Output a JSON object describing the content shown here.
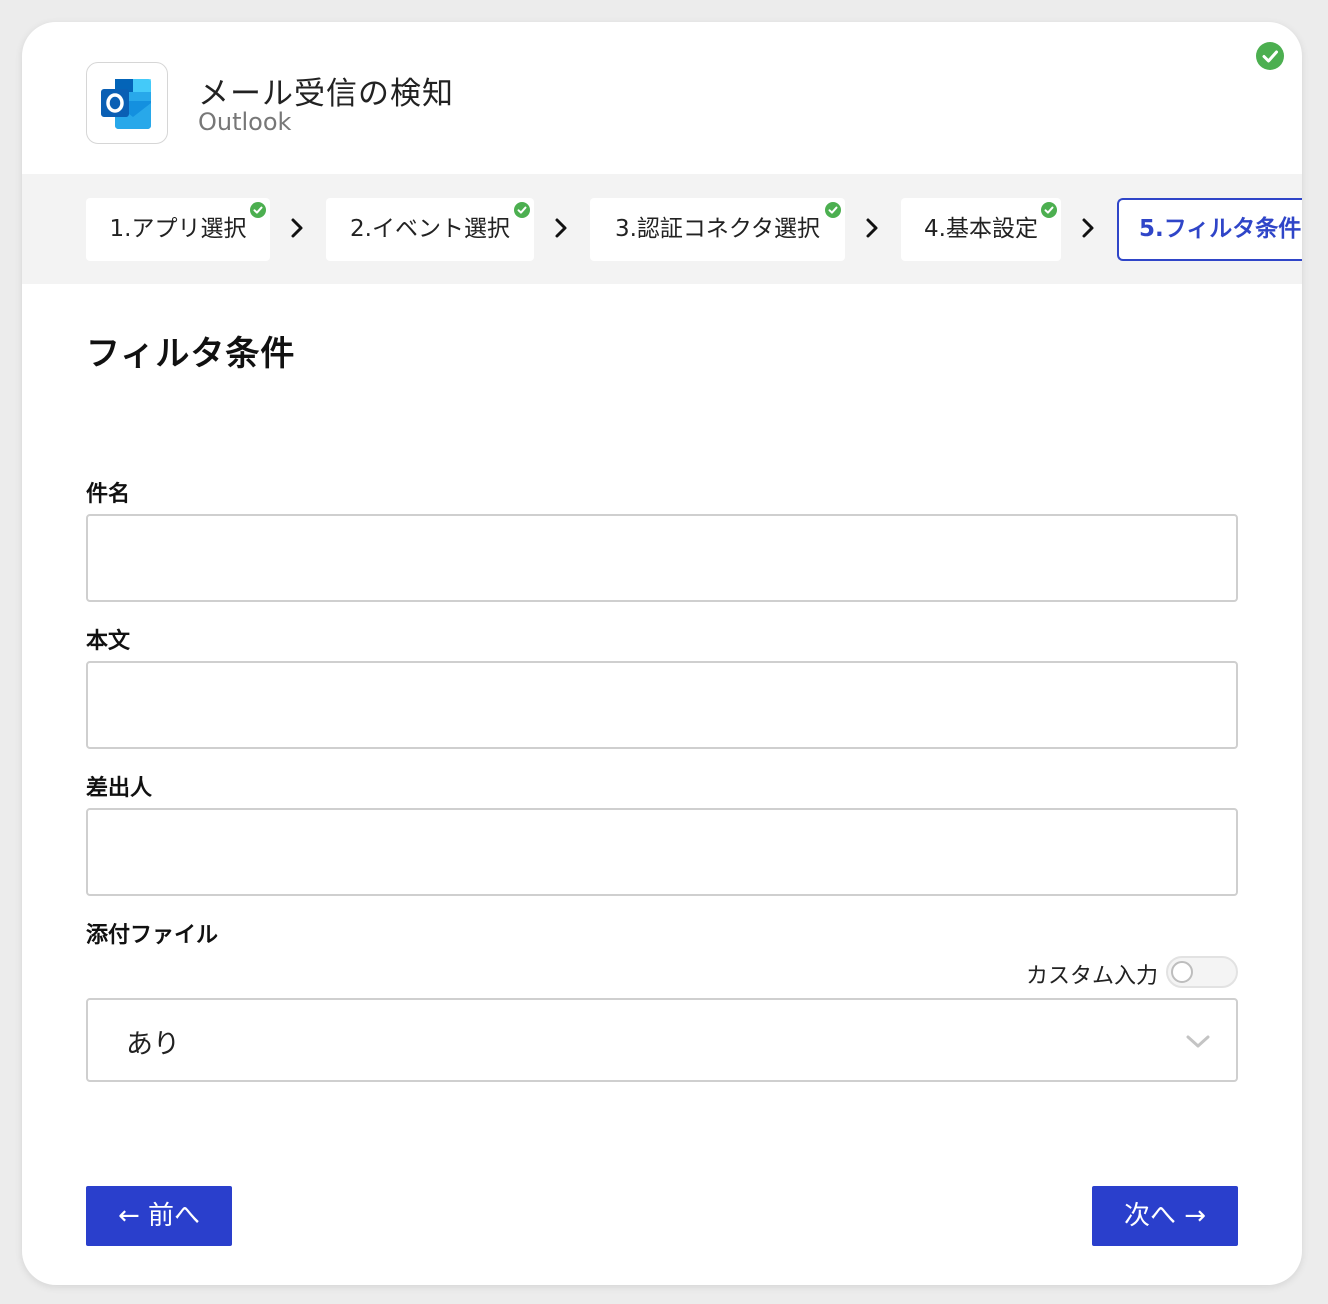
{
  "header": {
    "title": "メール受信の検知",
    "subtitle": "Outlook",
    "app_icon": "outlook-icon",
    "status_icon": "check-circle-icon"
  },
  "stepper": {
    "steps": [
      {
        "label": "1.アプリ選択",
        "done": true
      },
      {
        "label": "2.イベント選択",
        "done": true
      },
      {
        "label": "3.認証コネクタ選択",
        "done": true
      },
      {
        "label": "4.基本設定",
        "done": true
      },
      {
        "label": "5.フィルタ条件",
        "done": false,
        "active": true
      }
    ],
    "separator_icon": "chevron-right-icon"
  },
  "main": {
    "section_title": "フィルタ条件",
    "fields": {
      "subject": {
        "label": "件名",
        "value": ""
      },
      "body": {
        "label": "本文",
        "value": ""
      },
      "sender": {
        "label": "差出人",
        "value": ""
      },
      "attachment": {
        "label": "添付ファイル",
        "custom_input_label": "カスタム入力",
        "custom_input_on": false,
        "selected": "あり"
      }
    }
  },
  "footer": {
    "prev_label": "← 前へ",
    "next_label": "次へ →"
  },
  "colors": {
    "accent": "#2a3fcc",
    "active_step": "#2f45c8",
    "success": "#4caf50"
  }
}
